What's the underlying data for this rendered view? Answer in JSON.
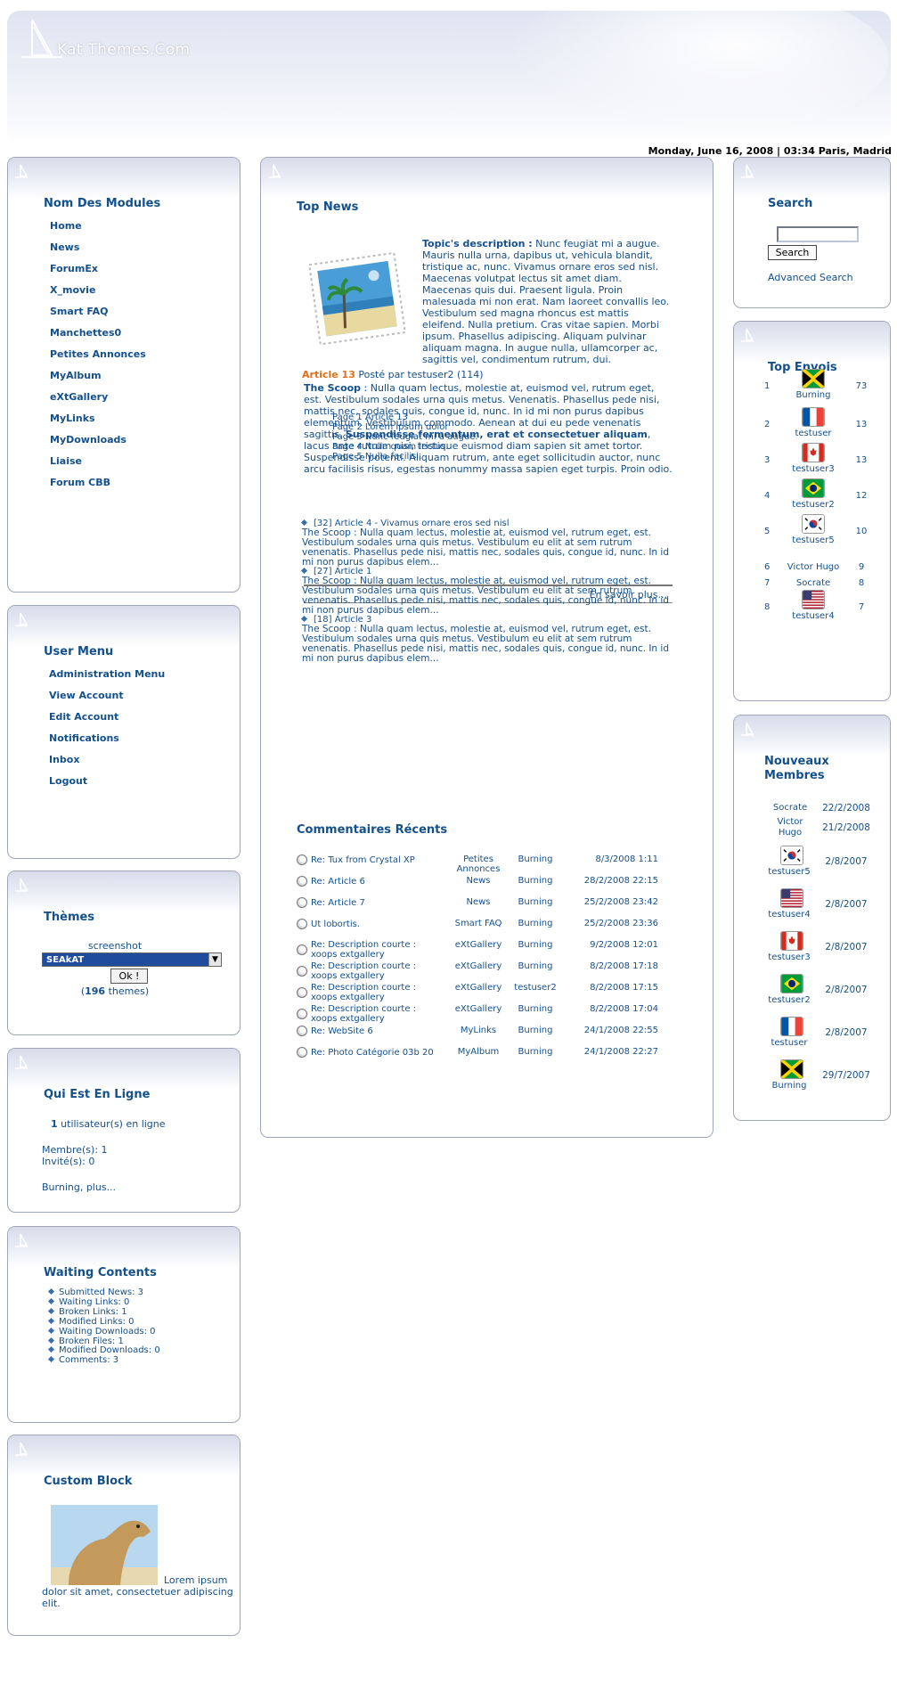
{
  "header": {
    "site_title": "Kat Themes.Com",
    "date": "Monday, June 16, 2008 | 03:34 Paris, Madrid"
  },
  "modules": {
    "title": "Nom Des Modules",
    "items": [
      "Home",
      "News",
      "ForumEx",
      "X_movie",
      "Smart FAQ",
      "Manchettes0",
      "Petites Annonces",
      "MyAlbum",
      "eXtGallery",
      "MyLinks",
      "MyDownloads",
      "Liaise",
      "Forum CBB"
    ]
  },
  "usermenu": {
    "title": "User Menu",
    "items": [
      "Administration Menu",
      "View Account",
      "Edit Account",
      "Notifications",
      "Inbox",
      "Logout"
    ]
  },
  "themes": {
    "title": "Thèmes",
    "screenshot": "screenshot",
    "selected": "SEAkAT",
    "ok": "Ok !",
    "count_prefix": "(",
    "count": "196",
    "count_suffix": " themes)"
  },
  "online": {
    "title": "Qui Est En Ligne",
    "count": "1",
    "count_text": " utilisateur(s) en ligne",
    "members": "Membre(s): 1",
    "guests": "Invité(s): 0",
    "more": "Burning, plus..."
  },
  "waiting": {
    "title": "Waiting Contents",
    "items": [
      "Submitted News: 3",
      "Waiting Links: 0",
      "Broken Links: 1",
      "Modified Links: 0",
      "Waiting Downloads: 0",
      "Broken Files: 1",
      "Modified Downloads: 0",
      "Comments: 3"
    ]
  },
  "custom": {
    "title": "Custom Block",
    "text": "Lorem ipsum dolor sit amet, consectetuer adipiscing elit."
  },
  "topnews": {
    "title": "Top News",
    "desc_label": "Topic's description :",
    "desc_text": " Nunc feugiat mi a augue. Mauris nulla urna, dapibus ut, vehicula blandit, tristique ac, nunc. Vivamus ornare eros sed nisl. Maecenas volutpat lectus sit amet diam. Maecenas quis dui. Praesent ligula. Proin malesuada mi non erat. Nam laoreet convallis leo. Vestibulum sed magna rhoncus est mattis eleifend. Nulla pretium. Cras vitae sapien. Morbi ipsum. Phasellus adipiscing. Aliquam pulvinar aliquam magna. In augue nulla, ullamcorper ac, sagittis vel, condimentum rutrum, dui.",
    "article_label": "Article 13",
    "article_meta": " Posté par testuser2 (114)",
    "scoop_label": "The Scoop",
    "scoop_text_a": " : Nulla quam lectus, molestie at, euismod vel, rutrum eget, est. Vestibulum sodales urna quis metus. Venenatis. Phasellus pede nisi, mattis nec, sodales quis, congue id, nunc. In id mi non purus dapibus elementum. Vestibulum commodo. Aenean at dui eu pede venenatis sagittis. ",
    "scoop_bold": "Suspendisse fermentum, erat et consectetuer aliquam",
    "scoop_text_b": ", lacus ante rutrum nisi, tristique euismod diam sapien sit amet tortor. Suspendisse potenti. Aliquam rutrum, ante eget sollicitudin auctor, nunc arcu facilisis risus, egestas nonummy massa sapien eget turpis. Proin odio.",
    "pages": [
      "Page 1 Article 13",
      "Page 2 Lorem ipsum dolor",
      "Page 3 Nunc feugiat mi a augue.",
      "Page 4 Nulla quam lectus.",
      "Page 5 Nulla facilisi."
    ],
    "more": "En savoir plus...",
    "others": [
      {
        "head": "[32] Article 4 - Vivamus ornare eros sed nisl",
        "text": "The Scoop : Nulla quam lectus, molestie at, euismod vel, rutrum eget, est. Vestibulum sodales urna quis metus. Vestibulum eu elit at sem rutrum venenatis. Phasellus pede nisi, mattis nec, sodales quis, congue id, nunc. In id mi non purus dapibus elem..."
      },
      {
        "head": "[27] Article 1",
        "text": "The Scoop : Nulla quam lectus, molestie at, euismod vel, rutrum eget, est. Vestibulum sodales urna quis metus. Vestibulum eu elit at sem rutrum venenatis. Phasellus pede nisi, mattis nec, sodales quis, congue id, nunc. In id mi non purus dapibus elem..."
      },
      {
        "head": "[18] Article 3",
        "text": "The Scoop : Nulla quam lectus, molestie at, euismod vel, rutrum eget, est. Vestibulum sodales urna quis metus. Vestibulum eu elit at sem rutrum venenatis. Phasellus pede nisi, mattis nec, sodales quis, congue id, nunc. In id mi non purus dapibus elem..."
      }
    ]
  },
  "comments": {
    "title": "Commentaires Récents",
    "rows": [
      {
        "title": "Re: Tux from Crystal XP",
        "module": "Petites Annonces",
        "user": "Burning",
        "date": "8/3/2008 1:11"
      },
      {
        "title": "Re: Article 6",
        "module": "News",
        "user": "Burning",
        "date": "28/2/2008 22:15"
      },
      {
        "title": "Re: Article 7",
        "module": "News",
        "user": "Burning",
        "date": "25/2/2008 23:42"
      },
      {
        "title": "Ut lobortis.",
        "module": "Smart FAQ",
        "user": "Burning",
        "date": "25/2/2008 23:36"
      },
      {
        "title": "Re: Description courte : xoops extgallery",
        "module": "eXtGallery",
        "user": "Burning",
        "date": "9/2/2008 12:01"
      },
      {
        "title": "Re: Description courte : xoops extgallery",
        "module": "eXtGallery",
        "user": "Burning",
        "date": "8/2/2008 17:18"
      },
      {
        "title": "Re: Description courte : xoops extgallery",
        "module": "eXtGallery",
        "user": "testuser2",
        "date": "8/2/2008 17:15"
      },
      {
        "title": "Re: Description courte : xoops extgallery",
        "module": "eXtGallery",
        "user": "Burning",
        "date": "8/2/2008 17:04"
      },
      {
        "title": "Re: WebSite 6",
        "module": "MyLinks",
        "user": "Burning",
        "date": "24/1/2008 22:55"
      },
      {
        "title": "Re: Photo Catégorie 03b 20",
        "module": "MyAlbum",
        "user": "Burning",
        "date": "24/1/2008 22:27"
      }
    ]
  },
  "search": {
    "title": "Search",
    "button": "Search",
    "advanced": "Advanced Search",
    "value": ""
  },
  "topenvois": {
    "title": "Top Envois",
    "rows": [
      {
        "rank": "1",
        "user": "Burning",
        "count": "73",
        "flag": "jamaica"
      },
      {
        "rank": "2",
        "user": "testuser",
        "count": "13",
        "flag": "france"
      },
      {
        "rank": "3",
        "user": "testuser3",
        "count": "13",
        "flag": "canada"
      },
      {
        "rank": "4",
        "user": "testuser2",
        "count": "12",
        "flag": "brazil"
      },
      {
        "rank": "5",
        "user": "testuser5",
        "count": "10",
        "flag": "korea"
      },
      {
        "rank": "6",
        "user": "Victor Hugo",
        "count": "9",
        "flag": ""
      },
      {
        "rank": "7",
        "user": "Socrate",
        "count": "8",
        "flag": ""
      },
      {
        "rank": "8",
        "user": "testuser4",
        "count": "7",
        "flag": "usa"
      }
    ]
  },
  "newmembers": {
    "title_line1": "Nouveaux",
    "title_line2": "Membres",
    "rows": [
      {
        "user": "Socrate",
        "date": "22/2/2008",
        "flag": ""
      },
      {
        "user": "Victor Hugo",
        "date": "21/2/2008",
        "flag": ""
      },
      {
        "user": "testuser5",
        "date": "2/8/2007",
        "flag": "korea"
      },
      {
        "user": "testuser4",
        "date": "2/8/2007",
        "flag": "usa"
      },
      {
        "user": "testuser3",
        "date": "2/8/2007",
        "flag": "canada"
      },
      {
        "user": "testuser2",
        "date": "2/8/2007",
        "flag": "brazil"
      },
      {
        "user": "testuser",
        "date": "2/8/2007",
        "flag": "france"
      },
      {
        "user": "Burning",
        "date": "29/7/2007",
        "flag": "jamaica"
      }
    ]
  },
  "colors": {
    "text": "#14508c",
    "accent_orange": "#e0701a",
    "border": "#9ea6b8"
  }
}
